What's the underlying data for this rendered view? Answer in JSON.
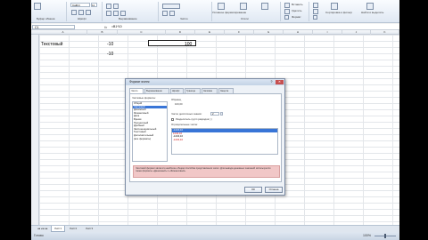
{
  "ribbon": {
    "font_name": "Calibri",
    "font_size": "11",
    "groups": [
      {
        "label": "Буфер обмена"
      },
      {
        "label": "Шрифт"
      },
      {
        "label": "Выравнивание"
      },
      {
        "label": "Число"
      },
      {
        "label": "Стили"
      },
      {
        "label": "Ячейки"
      },
      {
        "label": "Редактирование"
      }
    ],
    "buttons": {
      "conditional_format": "Условное форматирование",
      "format_table": "Форматировать как таблицу",
      "cell_styles": "Стили ячеек",
      "insert": "Вставить",
      "delete": "Удалить",
      "format": "Формат",
      "sort_filter": "Сортировка и фильтр",
      "find_select": "Найти и выделить"
    }
  },
  "formula_bar": {
    "name_box": "C1",
    "fx": "fx",
    "formula": "=B1*10"
  },
  "columns": [
    "A",
    "B",
    "C",
    "D",
    "E",
    "F",
    "G",
    "H",
    "I",
    "J",
    "K",
    "L"
  ],
  "cells": {
    "a1": "Текстовый",
    "b1": "-10",
    "c1": "100",
    "b2": "-10"
  },
  "dialog": {
    "title": "Формат ячеек",
    "help": "?",
    "close": "✕",
    "tabs": [
      "Число",
      "Выравнивание",
      "Шрифт",
      "Граница",
      "Заливка",
      "Защита"
    ],
    "formats_label": "Числовые форматы:",
    "formats": [
      "Общий",
      "Числовой",
      "Денежный",
      "Финансовый",
      "Дата",
      "Время",
      "Процентный",
      "Дробный",
      "Экспоненциальный",
      "Текстовый",
      "Дополнительный",
      "(все форматы)"
    ],
    "selected_format_index": 1,
    "sample_label": "Образец",
    "sample_value": "100,00",
    "decimals_label": "Число десятичных знаков:",
    "decimals_value": "2",
    "separator_label": "Разделитель групп разрядов ( )",
    "negative_label": "Отрицательные числа:",
    "negative_options": [
      "-1234,10",
      "1234,10",
      "-1234,10",
      "-1234,10"
    ],
    "negative_red": [
      false,
      true,
      false,
      true
    ],
    "selected_negative_index": 0,
    "description": "Числовой формат является наиболее общим способом представления чисел. Для вывода денежных значений используются также форматы «Денежный» и «Финансовый».",
    "ok": "ОК",
    "cancel": "Отмена"
  },
  "sheet_tabs": [
    "Лист1",
    "Лист2",
    "Лист3"
  ],
  "active_sheet_index": 0,
  "status": {
    "left": "Готово",
    "zoom": "100%"
  }
}
